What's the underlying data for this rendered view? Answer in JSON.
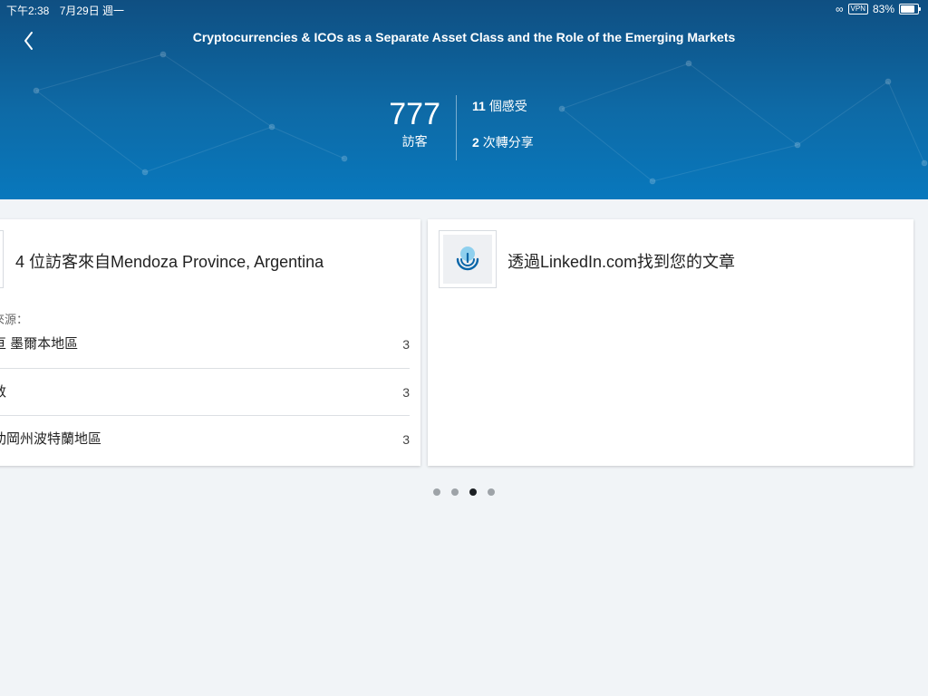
{
  "status_bar": {
    "time": "下午2:38",
    "date": "7月29日 週一",
    "vpn": "VPN",
    "battery": "83%"
  },
  "header": {
    "title": "Cryptocurrencies & ICOs as a Separate Asset Class and the Role of the Emerging Markets"
  },
  "stats": {
    "visitors_count": "777",
    "visitors_label": "訪客",
    "reactions_count": "11",
    "reactions_label": "個感受",
    "reshares_count": "2",
    "reshares_label": "次轉分享"
  },
  "cards": [
    {
      "headline": "4 位訪客來自Mendoza Province, Argentina",
      "source_label": "來源：",
      "rows": [
        {
          "name": "亘 墨爾本地區",
          "count": "3"
        },
        {
          "name": "敦",
          "count": "3"
        },
        {
          "name": "肋岡州波特蘭地區",
          "count": "3"
        }
      ]
    },
    {
      "headline": "透過LinkedIn.com找到您的文章"
    }
  ],
  "pager": {
    "count": 4,
    "active_index": 2
  },
  "colors": {
    "hero_top": "#0f4f82",
    "hero_bottom": "#0878bd",
    "page_bg": "#f1f4f7",
    "active_dot": "#1b1f23",
    "inactive_dot": "#9ea3a8"
  }
}
